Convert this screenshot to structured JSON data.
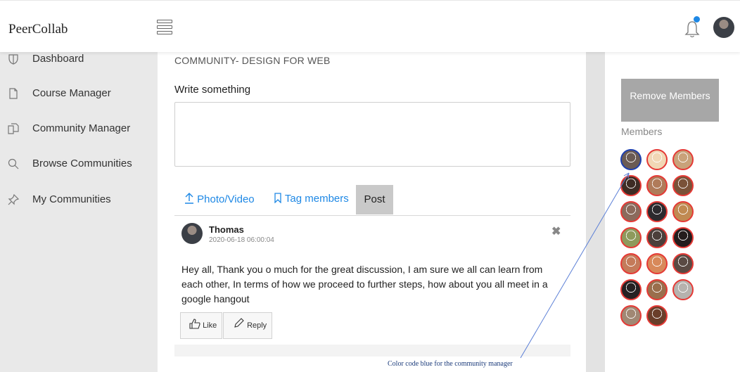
{
  "app": {
    "brand": "PeerCollab"
  },
  "sidebar": {
    "items": [
      {
        "label": "Dashboard",
        "icon": "shield-icon"
      },
      {
        "label": "Course Manager",
        "icon": "document-icon"
      },
      {
        "label": "Community Manager",
        "icon": "copy-icon"
      },
      {
        "label": "Browse Communities",
        "icon": "search-icon"
      },
      {
        "label": "My Communities",
        "icon": "pin-icon"
      }
    ]
  },
  "main": {
    "title": "COMMUNITY- DESIGN FOR WEB",
    "write_label": "Write something",
    "actions": {
      "photo_video": "Photo/Video",
      "tag_members": "Tag members",
      "post": "Post"
    }
  },
  "post": {
    "author": "Thomas",
    "date": "2020-06-18 06:00:04",
    "body": "Hey all, Thank you o much for the great discussion, I am sure we all can learn from each other, In terms of how we proceed to further steps, how about you all meet in a google hangout",
    "like_label": "Like",
    "reply_label": "Reply"
  },
  "right": {
    "remove_button": "Remove Members",
    "members_label": "Members",
    "members": [
      {
        "border": "#1e3fae",
        "role": "community-manager"
      },
      {
        "border": "#e53935"
      },
      {
        "border": "#e53935"
      },
      {
        "border": "#e53935"
      },
      {
        "border": "#e53935"
      },
      {
        "border": "#e53935"
      },
      {
        "border": "#e53935"
      },
      {
        "border": "#e53935"
      },
      {
        "border": "#e53935"
      },
      {
        "border": "#e53935"
      },
      {
        "border": "#e53935"
      },
      {
        "border": "#e53935"
      },
      {
        "border": "#e53935"
      },
      {
        "border": "#e53935"
      },
      {
        "border": "#e53935"
      },
      {
        "border": "#e53935"
      },
      {
        "border": "#e53935"
      },
      {
        "border": "#e53935"
      },
      {
        "border": "#e53935"
      },
      {
        "border": "#e53935"
      }
    ]
  },
  "annotation": "Color code blue for the community manager",
  "colors": {
    "accent": "#1e88e5",
    "manager": "#1e3fae",
    "member": "#e53935"
  }
}
